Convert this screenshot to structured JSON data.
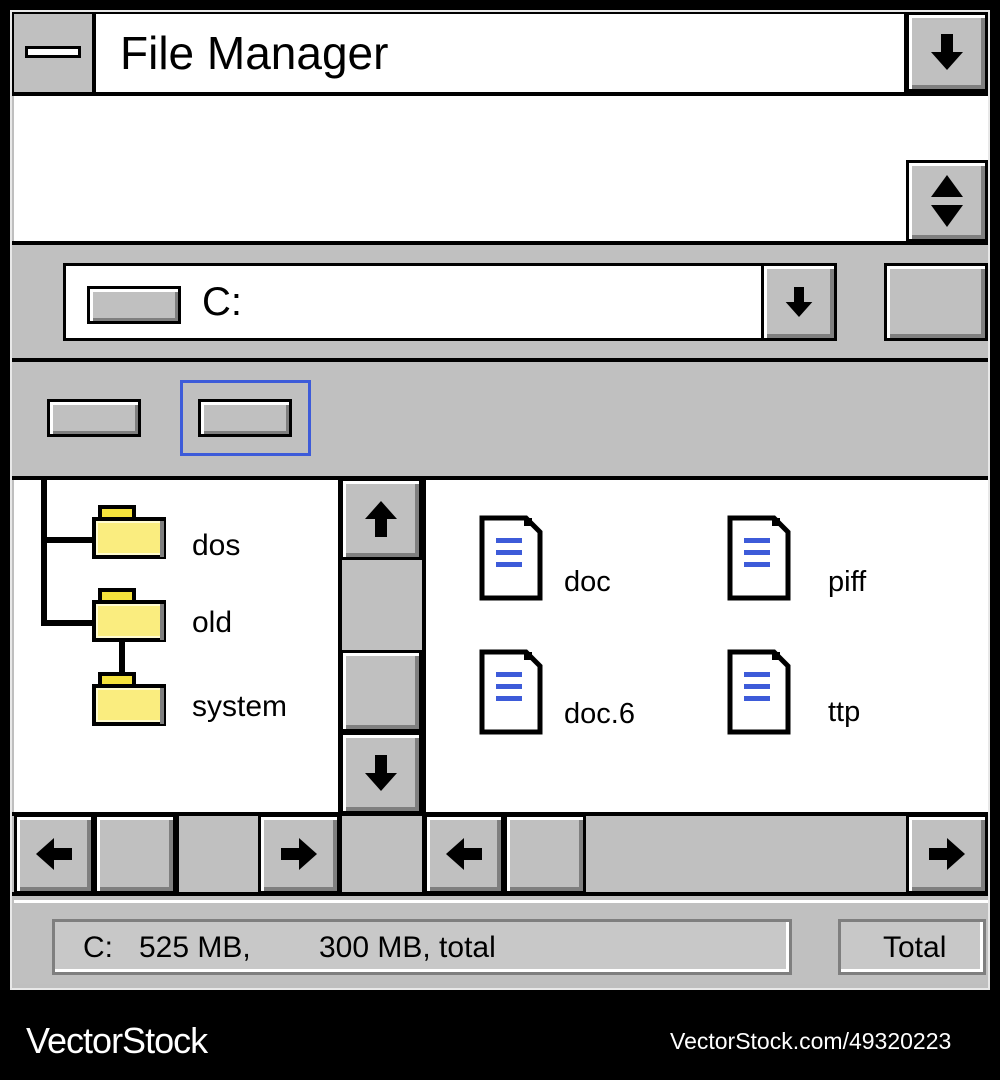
{
  "window": {
    "title": "File Manager"
  },
  "drive_selector": {
    "value": "C:"
  },
  "tree": {
    "items": [
      {
        "label": "dos"
      },
      {
        "label": "old"
      },
      {
        "label": "system"
      }
    ]
  },
  "files": [
    {
      "name": "doc"
    },
    {
      "name": "piff"
    },
    {
      "name": "doc.6"
    },
    {
      "name": "ttp"
    }
  ],
  "status_bar": {
    "drive": "C:",
    "free": "525 MB,",
    "total": "300 MB, total",
    "total_button": "Total"
  },
  "watermark": {
    "brand": "VectorStock",
    "url": "VectorStock.com/49320223"
  },
  "icons": {
    "system_menu": "system-menu-icon",
    "arrow_down": "arrow-down-icon",
    "arrow_up": "arrow-up-icon",
    "arrow_left": "arrow-left-icon",
    "arrow_right": "arrow-right-icon",
    "folder": "folder-icon",
    "document": "document-icon"
  },
  "colors": {
    "face": "#c0c0c0",
    "focus_border": "#3d5bd9",
    "folder_yellow": "#f5e23c",
    "doc_lines": "#3d5bd9"
  }
}
